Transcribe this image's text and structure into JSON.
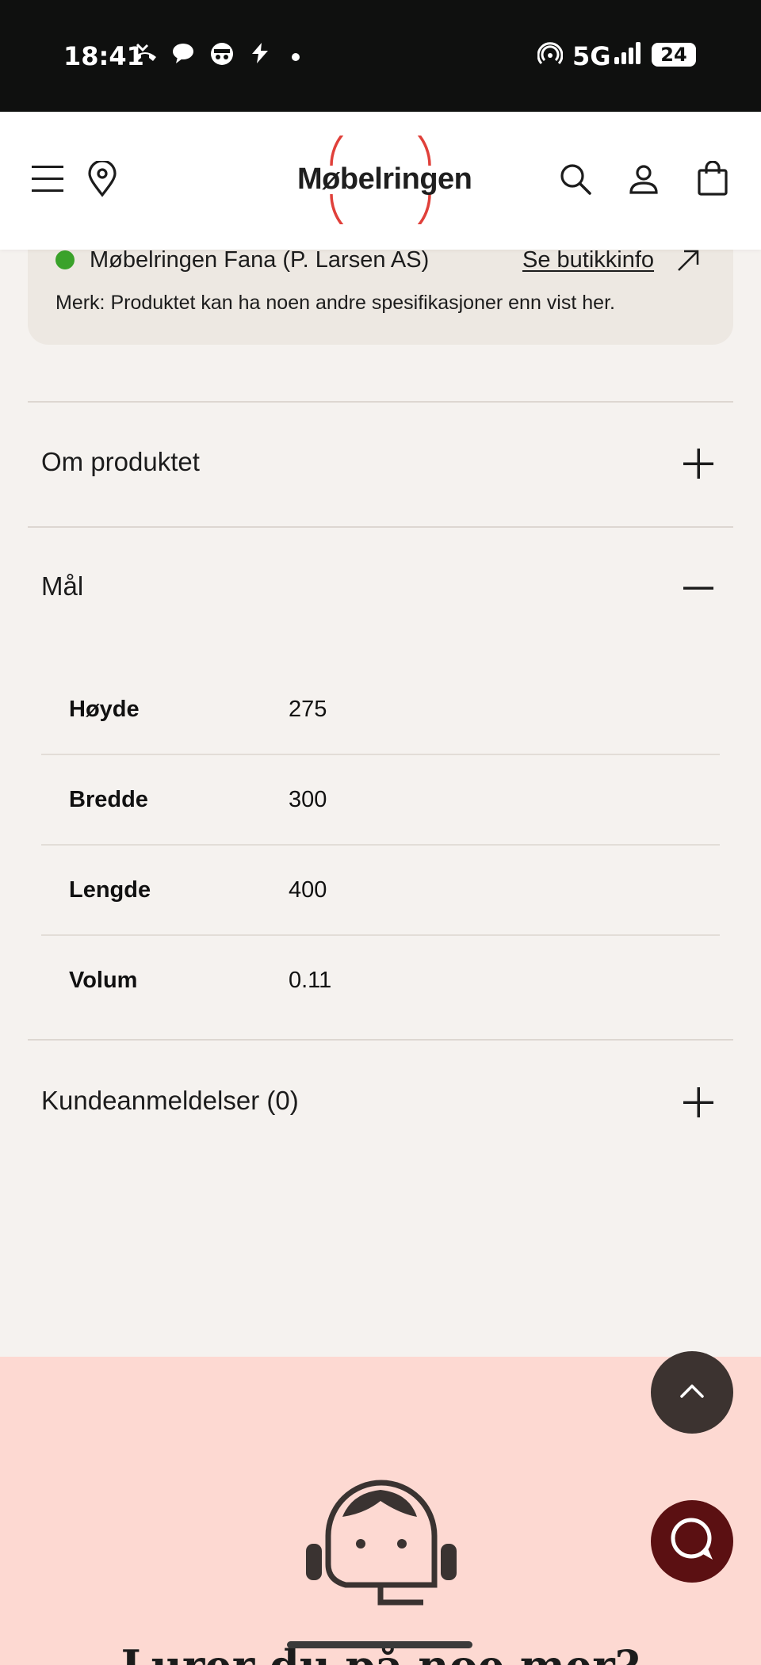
{
  "status_bar": {
    "time": "18:41",
    "network": "5G",
    "battery": "24"
  },
  "header": {
    "logo_text": "Møbelringen",
    "icons": [
      "menu-icon",
      "location-pin-icon",
      "search-icon",
      "user-icon",
      "cart-icon"
    ]
  },
  "store": {
    "name": "Møbelringen Fana (P. Larsen AS)",
    "link": "Se butikkinfo",
    "note": "Merk: Produktet kan ha noen andre spesifikasjoner enn vist her.",
    "status_color": "#3aa22a"
  },
  "accordion": {
    "about": "Om produktet",
    "dimensions": "Mål",
    "reviews": "Kundeanmeldelser (0)"
  },
  "specs": [
    {
      "label": "Høyde",
      "value": "275"
    },
    {
      "label": "Bredde",
      "value": "300"
    },
    {
      "label": "Lengde",
      "value": "400"
    },
    {
      "label": "Volum",
      "value": "0.11"
    }
  ],
  "help": {
    "headline": "Lurer du på noe mer?"
  },
  "colors": {
    "accent": "#e0403a",
    "help_bg": "#fdd9d2",
    "chat_button": "#5b1012",
    "scroll_top_button": "#3c3330"
  }
}
